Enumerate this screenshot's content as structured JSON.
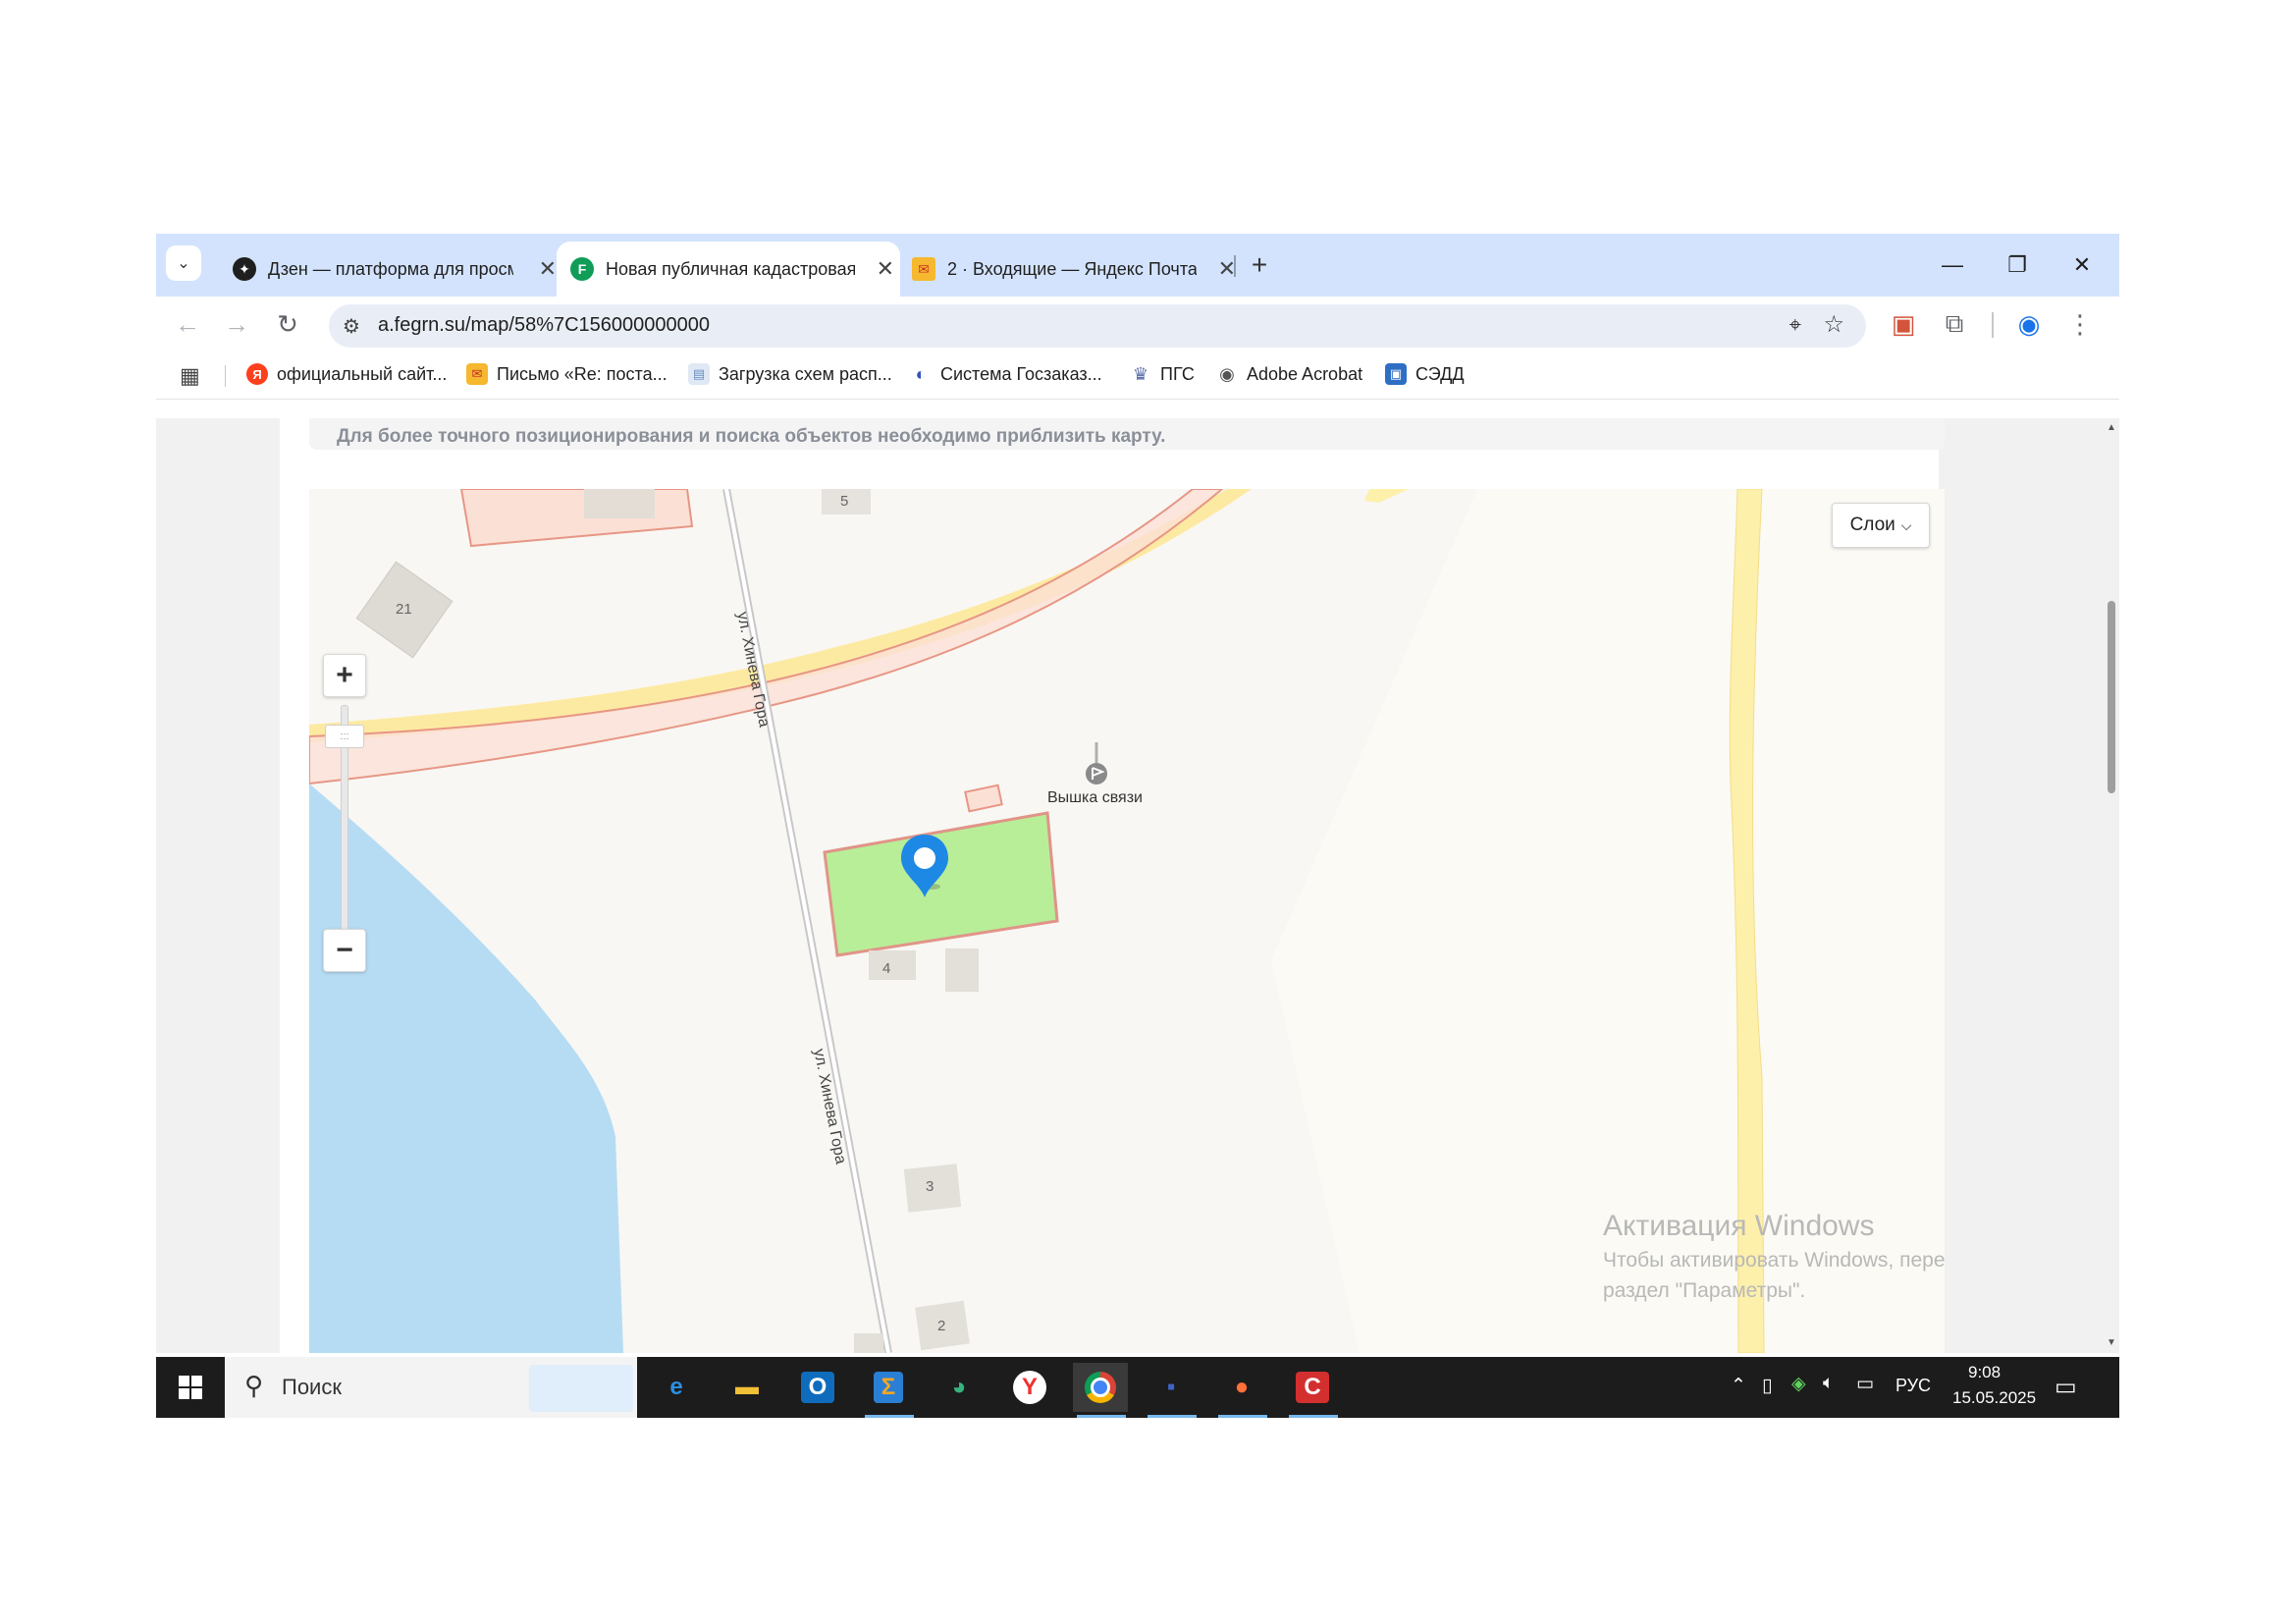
{
  "browser": {
    "tabs": [
      {
        "title": "Дзен — платформа для просм",
        "icon": "dzen-icon",
        "active": false
      },
      {
        "title": "Новая публичная кадастровая",
        "icon": "fegrn-icon",
        "active": true
      },
      {
        "title": "2 · Входящие — Яндекс Почта",
        "icon": "yandex-mail-icon",
        "active": false
      }
    ],
    "new_tab": "+",
    "url": "a.fegrn.su/map/58%7C156000000000",
    "bookmarks": [
      {
        "label": "официальный сайт...",
        "icon": "yandex-icon",
        "color": "#fc3f1d",
        "glyph": "Я"
      },
      {
        "label": "Письмо «Re: поста...",
        "icon": "mail-icon",
        "color": "#f5b82e",
        "glyph": "✉"
      },
      {
        "label": "Загрузка схем расп...",
        "icon": "document-icon",
        "color": "#7aa7d8",
        "glyph": "▤"
      },
      {
        "label": "Система Госзаказ...",
        "icon": "goszakaz-icon",
        "color": "#3552b8",
        "glyph": "◐"
      },
      {
        "label": "ПГС",
        "icon": "emblem-icon",
        "color": "#5a6ea8",
        "glyph": "♛"
      },
      {
        "label": "Adobe Acrobat",
        "icon": "globe-icon",
        "color": "#555555",
        "glyph": "◉"
      },
      {
        "label": "СЭДД",
        "icon": "briefcase-icon",
        "color": "#2e6fc4",
        "glyph": "▣"
      }
    ]
  },
  "page": {
    "notice": "Для более точного позиционирования и поиска объектов необходимо приблизить карту.",
    "layers_button": "Слои",
    "map": {
      "street_label": "ул. Хинева Гора",
      "poi_label": "Вышка связи",
      "building_numbers": [
        "5",
        "21",
        "4",
        "3",
        "2"
      ]
    },
    "watermark": {
      "title": "Активация Windows",
      "text": "Чтобы активировать Windows, перейдите в раздел \"Параметры\"."
    }
  },
  "taskbar": {
    "search_label": "Поиск",
    "language": "РУС",
    "time": "9:08",
    "date": "15.05.2025"
  }
}
